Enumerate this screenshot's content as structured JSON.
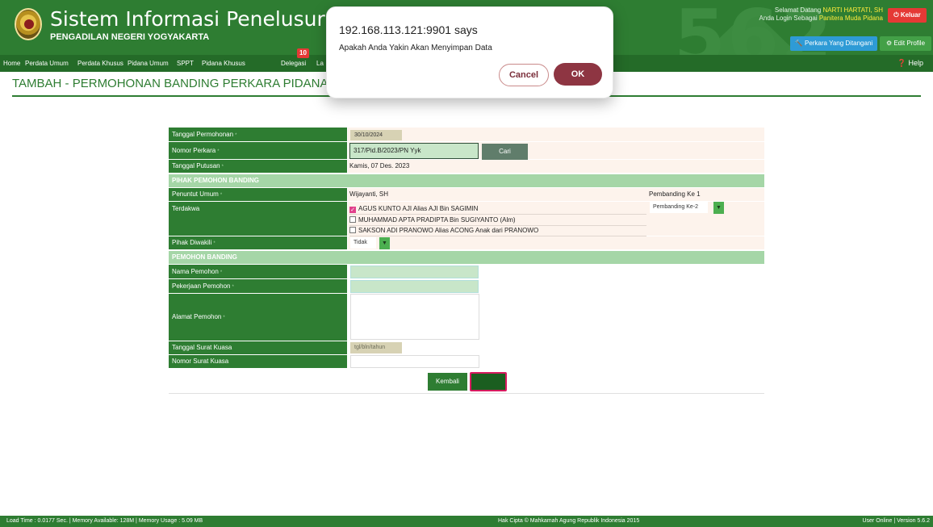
{
  "header": {
    "title": "Sistem Informasi Penelusuran Perkara",
    "subtitle": "PENGADILAN NEGERI YOGYAKARTA",
    "bg_version": "562",
    "welcome_prefix": "Selamat Datang",
    "user_name": "NARTI HARTATI, SH",
    "login_prefix": "Anda Login Sebagai",
    "role": "Panitera Muda Pidana",
    "logout_label": "⏻ Keluar",
    "perkara_label": "🔨 Perkara Yang Ditangani",
    "edit_profile_label": "⚙ Edit Profile"
  },
  "nav": {
    "items": [
      "Home",
      "Perdata Umum",
      "Perdata Khusus",
      "Pidana Umum",
      "SPPT",
      "Pidana Khusus",
      "Delegasi",
      "La"
    ],
    "delegasi_badge": "10",
    "help_label": "❓ Help"
  },
  "page": {
    "title": "TAMBAH - PERMOHONAN BANDING PERKARA PIDANA BIASA (e-"
  },
  "form": {
    "labels": {
      "tanggal_permohonan": "Tanggal Permohonan",
      "nomor_perkara": "Nomor Perkara",
      "tanggal_putusan": "Tanggal Putusan",
      "penuntut_umum": "Penuntut Umum",
      "terdakwa": "Terdakwa",
      "pihak_diwakili": "Pihak Diwakili",
      "nama_pemohon": "Nama Pemohon",
      "pekerjaan_pemohon": "Pekerjaan Pemohon",
      "alamat_pemohon": "Alamat Pemohon",
      "tanggal_surat_kuasa": "Tanggal Surat Kuasa",
      "nomor_surat_kuasa": "Nomor Surat Kuasa"
    },
    "sections": {
      "pihak": "PIHAK PEMOHON BANDING",
      "pemohon": "PEMOHON BANDING"
    },
    "values": {
      "tanggal_permohonan": "30/10/2024",
      "nomor_perkara": "317/Pid.B/2023/PN Yyk",
      "tanggal_putusan": "Kamis, 07 Des. 2023",
      "penuntut_umum": "Wijayanti, SH",
      "pembanding_ke_label": "Pembanding Ke 1",
      "pembanding_select": "Pembanding Ke-2",
      "pihak_diwakili": "Tidak",
      "tanggal_surat_kuasa_placeholder": "tgl/bln/tahun"
    },
    "terdakwa": [
      {
        "name": "AGUS KUNTO AJI Alias AJI Bin SAGIMIN",
        "checked": true
      },
      {
        "name": "MUHAMMAD APTA PRADIPTA Bin SUGIYANTO (Alm)",
        "checked": false
      },
      {
        "name": "SAKSON ADI PRANOWO Alias ACONG Anak dari PRANOWO",
        "checked": false
      }
    ],
    "cari_label": "Cari",
    "kembali_label": "Kembali"
  },
  "footer": {
    "left": "Load Time : 0.0177 Sec. | Memory Available: 128M | Memory Usage : 5.09 MB",
    "center": "Hak Cipta © Mahkamah Agung Republik Indonesia 2015",
    "right": "User Online | Version 5.6.2"
  },
  "dialog": {
    "title": "192.168.113.121:9901 says",
    "message": "Apakah Anda Yakin Akan Menyimpan Data",
    "cancel_label": "Cancel",
    "ok_label": "OK"
  }
}
